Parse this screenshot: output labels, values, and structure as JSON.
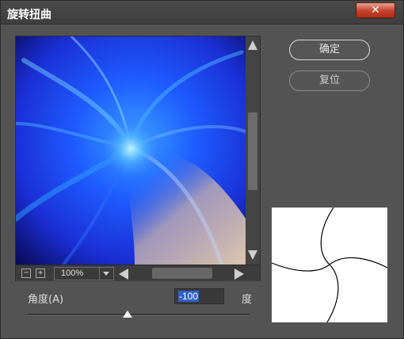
{
  "window": {
    "title": "旋转扭曲",
    "close_label": "✕"
  },
  "buttons": {
    "ok_label": "确定",
    "reset_label": "复位"
  },
  "preview": {
    "zoom_out_icon": "minus-icon",
    "zoom_in_icon": "plus-icon",
    "zoom_value": "100%"
  },
  "angle": {
    "label": "角度(A)",
    "value": "-100",
    "unit": "度",
    "slider_fraction": 0.45
  },
  "colors": {
    "dialog_bg": "#535353",
    "selection": "#2f62c9",
    "close_button": "#c4402b"
  }
}
